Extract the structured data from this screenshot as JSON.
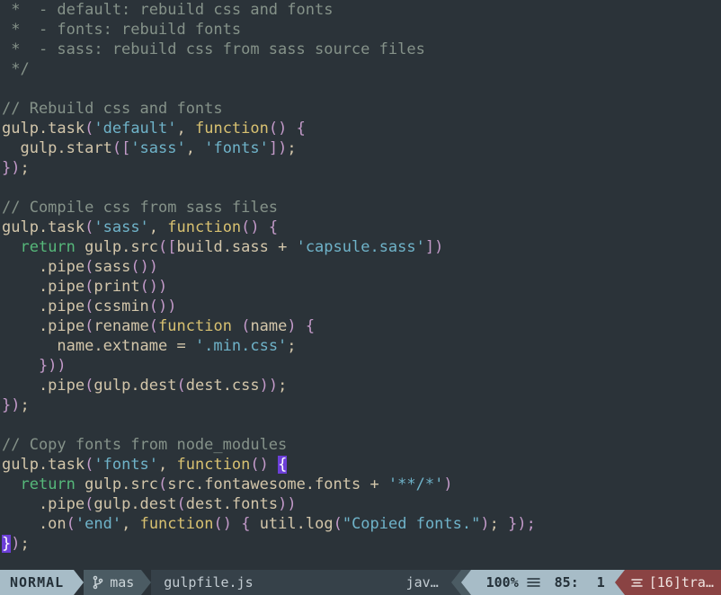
{
  "window": {
    "app": "vim",
    "background": "#2b3339",
    "foreground": "#d3c6aa"
  },
  "editor": {
    "filename": "gulpfile.js",
    "lines": [
      " *  - default: rebuild css and fonts",
      " *  - fonts: rebuild fonts",
      " *  - sass: rebuild css from sass source files",
      " */",
      "",
      "// Rebuild css and fonts",
      "gulp.task('default', function() {",
      "  gulp.start(['sass', 'fonts']);",
      "});",
      "",
      "// Compile css from sass files",
      "gulp.task('sass', function() {",
      "  return gulp.src([build.sass + 'capsule.sass'])",
      "    .pipe(sass())",
      "    .pipe(print())",
      "    .pipe(cssmin())",
      "    .pipe(rename(function (name) {",
      "      name.extname = '.min.css';",
      "    }))",
      "    .pipe(gulp.dest(dest.css));",
      "});",
      "",
      "// Copy fonts from node_modules",
      "gulp.task('fonts', function() {",
      "  return gulp.src(src.fontawesome.fonts + '**/*')",
      "    .pipe(gulp.dest(dest.fonts))",
      "    .on('end', function() { util.log(\"Copied fonts.\"); });",
      "});"
    ],
    "syntax_colors": {
      "comment": "#859289",
      "string": "#6fb3c9",
      "keyword": "#d8c171",
      "return": "#56b87a",
      "punctuation": "#c39ac9",
      "plain": "#d3c6aa",
      "match_paren_bg": "#6c3fd8"
    }
  },
  "statusline": {
    "mode": "NORMAL",
    "branch_icon": "git-branch-icon",
    "branch": "mas",
    "filename": "gulpfile.js",
    "filetype": "jav…",
    "percent": "100%",
    "position_icon": "lines-icon",
    "line": "85:",
    "column": "1",
    "warning_icon": "warning-lines-icon",
    "warning": "[16]tra…",
    "colors": {
      "mode_bg": "#a7bcc7",
      "mode_fg": "#243038",
      "branch_bg": "#4b5b63",
      "file_bg": "#364149",
      "warn_bg": "#8a4343"
    }
  }
}
